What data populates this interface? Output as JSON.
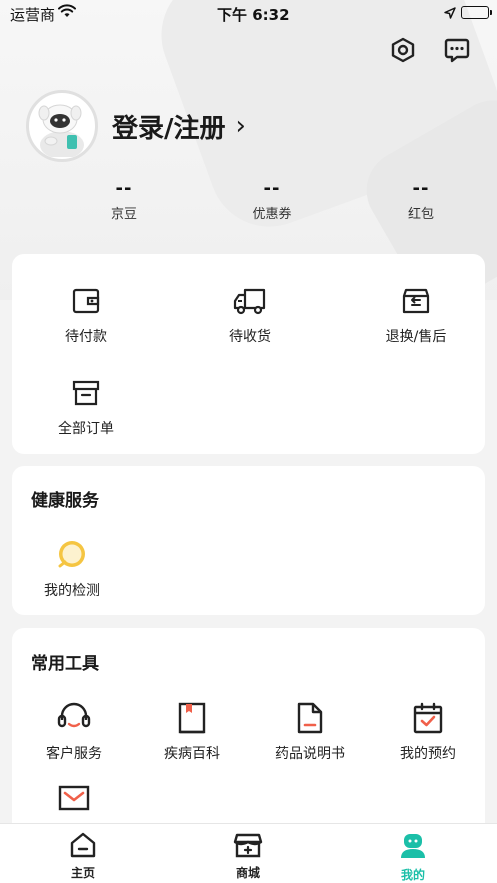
{
  "status_bar": {
    "carrier": "运营商",
    "time": "下午 6:32",
    "icons": [
      "wifi-icon",
      "location-arrow-icon",
      "battery-icon"
    ]
  },
  "header": {
    "icons": [
      "settings-hexagon-icon",
      "message-icon"
    ]
  },
  "profile": {
    "login_label": "登录/注册",
    "chevron": "›"
  },
  "stats": [
    {
      "value": "--",
      "label": "京豆"
    },
    {
      "value": "--",
      "label": "优惠券"
    },
    {
      "value": "--",
      "label": "红包"
    }
  ],
  "orders": {
    "items": [
      {
        "label": "待付款",
        "icon": "wallet-icon"
      },
      {
        "label": "待收货",
        "icon": "truck-icon"
      },
      {
        "label": "退换/售后",
        "icon": "return-box-icon"
      },
      {
        "label": "全部订单",
        "icon": "archive-box-icon"
      }
    ]
  },
  "health": {
    "title": "健康服务",
    "items": [
      {
        "label": "我的检测",
        "icon": "search-bubble-icon"
      }
    ]
  },
  "tools": {
    "title": "常用工具",
    "items": [
      {
        "label": "客户服务",
        "icon": "headset-icon"
      },
      {
        "label": "疾病百科",
        "icon": "book-icon"
      },
      {
        "label": "药品说明书",
        "icon": "document-icon"
      },
      {
        "label": "我的预约",
        "icon": "calendar-check-icon"
      },
      {
        "label": "",
        "icon": "mail-icon"
      }
    ]
  },
  "tabbar": {
    "tabs": [
      {
        "label": "主页",
        "icon": "home-icon"
      },
      {
        "label": "商城",
        "icon": "shop-icon"
      },
      {
        "label": "我的",
        "icon": "profile-robot-icon",
        "active": true
      }
    ]
  },
  "colors": {
    "accent": "#1bbfa8",
    "tool_accent": "#f0604a",
    "health_accent": "#f5c542"
  }
}
